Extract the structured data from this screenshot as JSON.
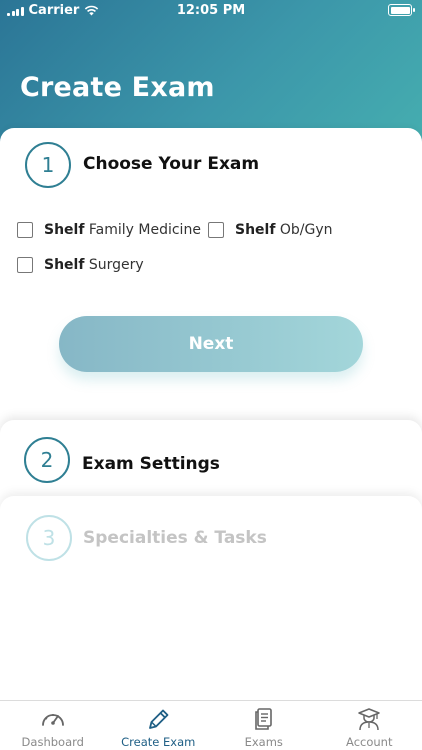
{
  "status_bar": {
    "carrier": "Carrier",
    "time": "12:05 PM"
  },
  "header": {
    "title": "Create Exam"
  },
  "steps": [
    {
      "number": "1",
      "title": "Choose Your Exam"
    },
    {
      "number": "2",
      "title": "Exam Settings"
    },
    {
      "number": "3",
      "title": "Specialties & Tasks"
    }
  ],
  "exam_options": [
    {
      "prefix": "Shelf",
      "name": "Family Medicine",
      "checked": false
    },
    {
      "prefix": "Shelf",
      "name": "Ob/Gyn",
      "checked": false
    },
    {
      "prefix": "Shelf",
      "name": "Surgery",
      "checked": false
    }
  ],
  "next_button": {
    "label": "Next"
  },
  "tabs": [
    {
      "label": "Dashboard",
      "icon": "speedometer-icon",
      "active": false
    },
    {
      "label": "Create Exam",
      "icon": "pencil-icon",
      "active": true
    },
    {
      "label": "Exams",
      "icon": "document-icon",
      "active": false
    },
    {
      "label": "Account",
      "icon": "graduate-icon",
      "active": false
    }
  ],
  "colors": {
    "header_start": "#2b7596",
    "header_end": "#46afb0",
    "accent": "#2f7f93",
    "active_tab": "#1f5f85",
    "inactive_tab": "#8a8a8a"
  }
}
